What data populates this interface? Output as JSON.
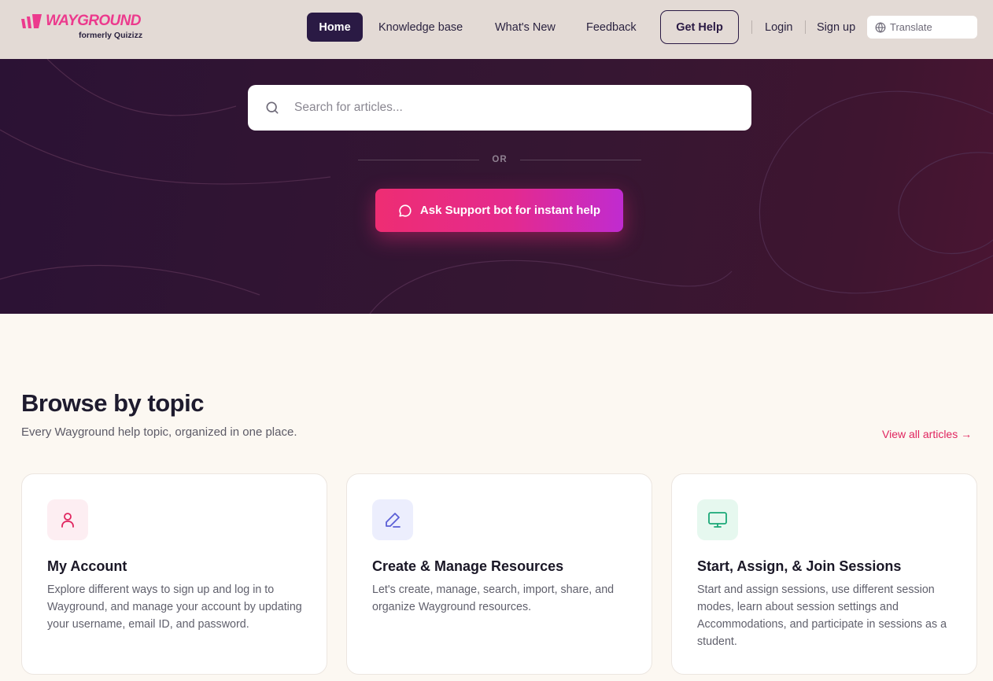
{
  "brand": {
    "name": "WAYGROUND",
    "subtitle": "formerly Quizizz",
    "color": "#ec3a8d"
  },
  "nav": {
    "home": "Home",
    "knowledge_base": "Knowledge base",
    "whats_new": "What's New",
    "feedback": "Feedback",
    "get_help": "Get Help",
    "login": "Login",
    "signup": "Sign up",
    "translate": "Translate"
  },
  "hero": {
    "search_placeholder": "Search for articles...",
    "or": "OR",
    "bot_button": "Ask Support bot for instant help"
  },
  "browse": {
    "title": "Browse by topic",
    "subtitle": "Every Wayground help topic, organized in one place.",
    "view_all": "View all articles →"
  },
  "cards": [
    {
      "icon": "user-icon",
      "title": "My Account",
      "description": "Explore different ways to sign up and log in to Wayground, and manage your account by updating your username, email ID, and password."
    },
    {
      "icon": "pencil-icon",
      "title": "Create & Manage Resources",
      "description": "Let's create, manage, search, import, share, and organize Wayground resources."
    },
    {
      "icon": "monitor-icon",
      "title": "Start, Assign, & Join Sessions",
      "description": "Start and assign sessions, use different session modes, learn about session settings and Accommodations, and participate in sessions as a student."
    }
  ],
  "colors": {
    "accent": "#e0255f",
    "nav_active": "#2a1a44",
    "hero_bg": "#2b1234"
  }
}
